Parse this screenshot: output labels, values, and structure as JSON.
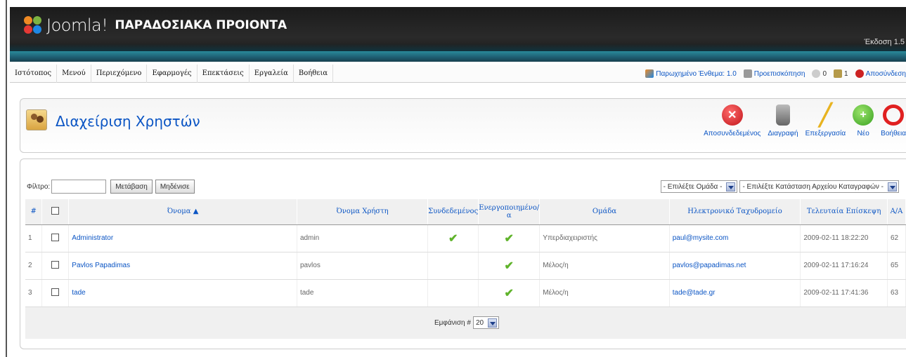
{
  "header": {
    "logo_text": "Joomla!",
    "site_title": "ΠΑΡΑΔΟΣΙΑΚΑ ΠΡΟΙΟΝΤΑ",
    "version": "Έκδοση 1.5"
  },
  "menu": [
    "Ιστότοπος",
    "Μενού",
    "Περιεχόμενο",
    "Εφαρμογές",
    "Επεκτάσεις",
    "Εργαλεία",
    "Βοήθεια"
  ],
  "status": {
    "module": "Παρωχημένο Ένθεμα: 1.0",
    "preview": "Προεπισκόπηση",
    "messages": "0",
    "users": "1",
    "logout": "Αποσύνδεση"
  },
  "toolbar": {
    "title": "Διαχείριση Χρηστών",
    "logout_label": "Αποσυνδεδεμένος",
    "delete_label": "Διαγραφή",
    "edit_label": "Επεξεργασία",
    "new_label": "Νέο",
    "help_label": "Βοήθεια"
  },
  "filter": {
    "label": "Φίλτρο:",
    "value": "",
    "go_label": "Μετάβαση",
    "reset_label": "Μηδένισε",
    "group_select": "- Επιλέξτε Ομάδα -",
    "log_select": "- Επιλέξτε Κατάσταση Αρχείου Καταγραφών -"
  },
  "table": {
    "headers": {
      "num": "#",
      "name": "Όνομα",
      "username": "Όνομα Χρήστη",
      "logged_in": "Συνδεδεμένος",
      "enabled": "Ενεργοποιημένο/α",
      "group": "Ομάδα",
      "email": "Ηλεκτρονικό Ταχυδρομείο",
      "last_visit": "Τελευταία Επίσκεψη",
      "id": "Α/Α"
    },
    "rows": [
      {
        "num": "1",
        "name": "Administrator",
        "username": "admin",
        "logged_in": true,
        "enabled": true,
        "group": "Υπερδιαχειριστής",
        "email": "paul@mysite.com",
        "last_visit": "2009-02-11 18:22:20",
        "id": "62"
      },
      {
        "num": "2",
        "name": "Pavlos Papadimas",
        "username": "pavlos",
        "logged_in": false,
        "enabled": true,
        "group": "Μέλος/η",
        "email": "pavlos@papadimas.net",
        "last_visit": "2009-02-11 17:16:24",
        "id": "65"
      },
      {
        "num": "3",
        "name": "tade",
        "username": "tade",
        "logged_in": false,
        "enabled": true,
        "group": "Μέλος/η",
        "email": "tade@tade.gr",
        "last_visit": "2009-02-11 17:41:36",
        "id": "63"
      }
    ],
    "footer": {
      "display_label": "Εμφάνιση #",
      "display_value": "20"
    }
  },
  "colors": {
    "link": "#0b55c4",
    "tick": "#5fb32a",
    "header_bg": "#1b1b1b",
    "accent": "#2a8a9a"
  }
}
